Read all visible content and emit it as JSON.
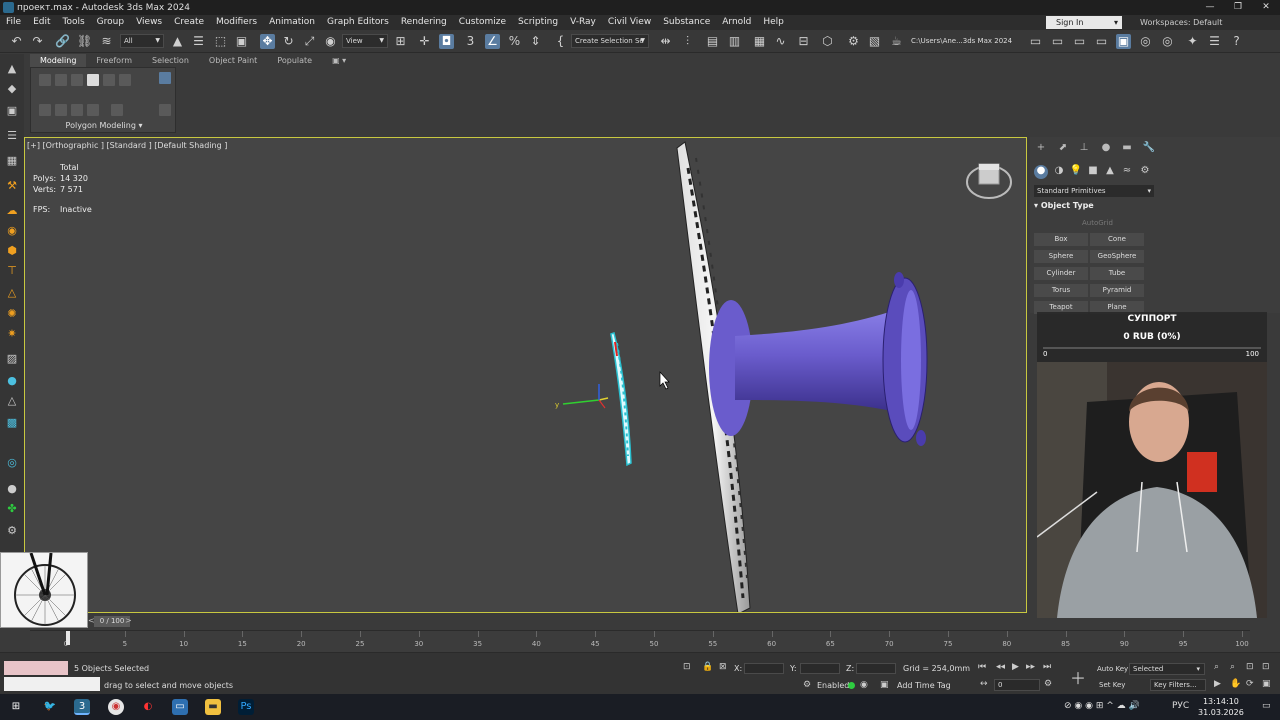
{
  "window": {
    "title": "проект.max - Autodesk 3ds Max 2024",
    "controls": [
      "—",
      "❐",
      "✕"
    ]
  },
  "menubar": {
    "items": [
      "File",
      "Edit",
      "Tools",
      "Group",
      "Views",
      "Create",
      "Modifiers",
      "Animation",
      "Graph Editors",
      "Rendering",
      "Customize",
      "Scripting",
      "V-Ray",
      "Civil View",
      "Substance",
      "Arnold",
      "Help"
    ],
    "signin": "Sign In",
    "workspace_label": "Workspaces:",
    "workspace_value": "Default"
  },
  "toolbar": {
    "filter_value": "All",
    "refcoord_value": "View",
    "selection_set": "Create Selection Se",
    "project_path": "C:\\Users\\Ane...3ds Max 2024"
  },
  "ribbon": {
    "tabs": [
      "Modeling",
      "Freeform",
      "Selection",
      "Object Paint",
      "Populate"
    ],
    "group_label": "Polygon Modeling"
  },
  "viewport": {
    "label": "[+] [Orthographic ] [Standard ] [Default Shading ]",
    "stats_total": "Total",
    "polys_label": "Polys:",
    "polys_value": "14 320",
    "verts_label": "Verts:",
    "verts_value": "7 571",
    "fps_label": "FPS:",
    "fps_value": "Inactive",
    "gizmo_x": "x",
    "gizmo_y": "y",
    "hub_color": "#6a5ccc"
  },
  "command_panel": {
    "category": "Standard Primitives",
    "rollout_title": "Object Type",
    "autogrid": "AutoGrid",
    "objects": [
      "Box",
      "Cone",
      "Sphere",
      "GeoSphere",
      "Cylinder",
      "Tube",
      "Torus",
      "Pyramid",
      "Teapot",
      "Plane"
    ]
  },
  "donation": {
    "title": "СУППОРТ",
    "amount": "0 RUB (0%)",
    "min": "0",
    "max": "100",
    "progress": 0
  },
  "timeslider": {
    "label": "0 / 100",
    "prev": "<",
    "next": ">"
  },
  "trackbar": {
    "ticks": [
      "0",
      "5",
      "10",
      "15",
      "20",
      "25",
      "30",
      "35",
      "40",
      "45",
      "50",
      "55",
      "60",
      "65",
      "70",
      "75",
      "80",
      "85",
      "90",
      "95",
      "100"
    ]
  },
  "statusbar": {
    "selection": "5 Objects Selected",
    "prompt": "drag to select and move objects",
    "x_label": "X:",
    "y_label": "Y:",
    "z_label": "Z:",
    "grid": "Grid = 254,0mm",
    "enabled_label": "Enabled:",
    "add_time_tag": "Add Time Tag",
    "autokey": "Auto Key",
    "setkey": "Set Key",
    "selected_dd": "Selected",
    "key_filters": "Key Filters...",
    "frame_value": "0"
  },
  "taskbar": {
    "lang": "РУС",
    "time": "13:14:10",
    "date": "31.03.2026"
  }
}
